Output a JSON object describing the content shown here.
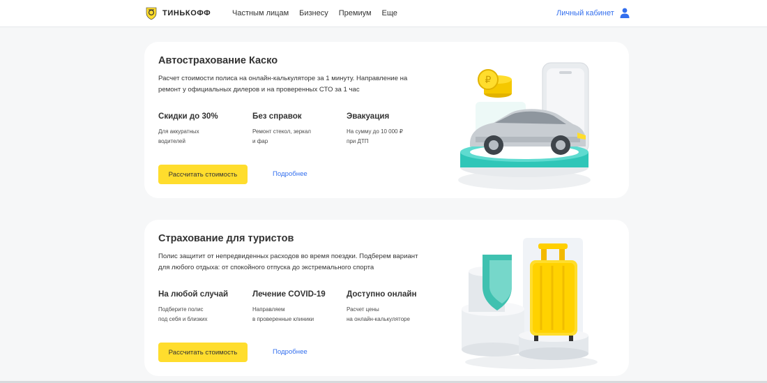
{
  "header": {
    "logo_text": "ТИНЬКОФФ",
    "nav": [
      "Частным лицам",
      "Бизнесу",
      "Премиум",
      "Еще"
    ],
    "account_label": "Личный кабинет"
  },
  "cards": [
    {
      "title": "Автострахование Каско",
      "description": "Расчет стоимости полиса на онлайн-калькуляторе за 1 минуту. Направление на ремонт у официальных дилеров и на проверенных СТО за 1 час",
      "features": [
        {
          "title": "Скидки до 30%",
          "text": "Для аккуратных\nводителей"
        },
        {
          "title": "Без справок",
          "text": "Ремонт стекол, зеркал\nи фар"
        },
        {
          "title": "Эвакуация",
          "text": "На сумму до 10 000 ₽\nпри ДТП"
        }
      ],
      "button_label": "Рассчитать стоимость",
      "link_label": "Подробнее"
    },
    {
      "title": "Страхование для туристов",
      "description": "Полис защитит от непредвиденных расходов во время поездки. Подберем вариант для любого отдыха: от спокойного отпуска до экстремального спорта",
      "features": [
        {
          "title": "На любой случай",
          "text": "Подберите полис\nпод себя и близких"
        },
        {
          "title": "Лечение COVID-19",
          "text": "Направляем\nв проверенные клиники"
        },
        {
          "title": "Доступно онлайн",
          "text": "Расчет цены\nна онлайн-калькуляторе"
        }
      ],
      "button_label": "Рассчитать стоимость",
      "link_label": "Подробнее"
    }
  ],
  "colors": {
    "accent_yellow": "#ffdd2d",
    "link_blue": "#336fee",
    "teal": "#2fc6b8",
    "background": "#f6f7f8"
  }
}
